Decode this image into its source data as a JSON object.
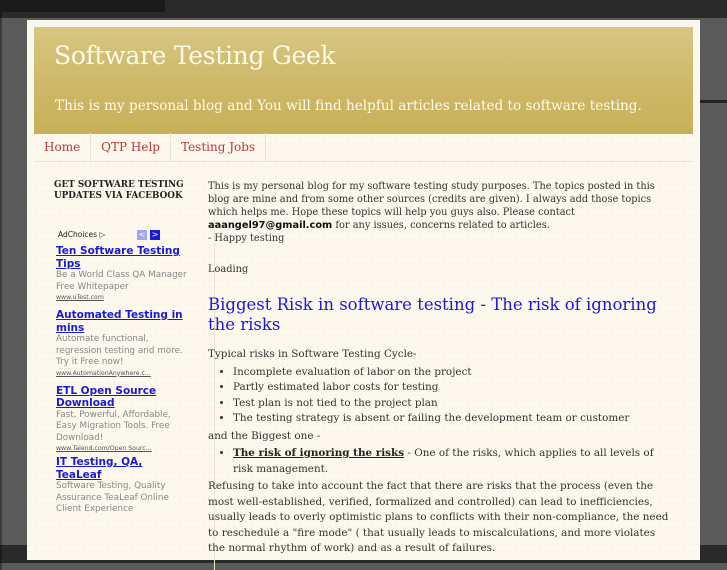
{
  "header": {
    "title": "Software Testing Geek",
    "description": "This is my personal blog and You will find helpful articles related to software testing."
  },
  "nav": {
    "items": [
      {
        "label": "Home"
      },
      {
        "label": "QTP Help"
      },
      {
        "label": "Testing Jobs"
      }
    ]
  },
  "sidebar": {
    "title": "GET SOFTWARE TESTING UPDATES VIA FACEBOOK",
    "adchoices_label": "AdChoices",
    "adchoices_icon": "adchoices-icon",
    "prev_icon": "chevron-left-icon",
    "next_icon": "chevron-right-icon",
    "prev_glyph": "<",
    "next_glyph": ">",
    "ads": [
      {
        "title": "Ten Software Testing Tips",
        "text": "Be a World Class QA Manager Free Whitepaper",
        "url": "www.uTest.com"
      },
      {
        "title": "Automated Testing in mins",
        "text": "Automate functional, regression testing and more. Try it Free now!",
        "url": "www.AutomationAnywhere.c..."
      },
      {
        "title": "ETL Open Source Download",
        "text": "Fast, Powerful, Affordable, Easy Migration Tools. Free Download!",
        "url": "www.Talend.com/Open Sourc..."
      },
      {
        "title": "IT Testing, QA, TeaLeaf",
        "text": "Software Testing, Quality Assurance TeaLeaf Online Client Experience",
        "url": ""
      }
    ]
  },
  "main": {
    "intro_before_email": "This is my personal blog for my software testing study purposes. The topics posted in this blog are mine and from some other sources (credits are given). I always add those topics which helps me. Hope these topics will help you guys also. Please contact ",
    "email": "aaangel97@gmail.com",
    "intro_after_email": " for any issues, concerns related to articles.",
    "signoff": "- Happy testing",
    "loading": "Loading",
    "post": {
      "title": "Biggest Risk in software testing - The risk of ignoring the risks",
      "lead": "Typical risks in Software Testing Cycle-",
      "risks": [
        "Incomplete evaluation of labor on the project",
        "Partly estimated labor costs for testing",
        "Test plan is not tied to the project plan",
        "The testing strategy is absent or failing the development team or customer"
      ],
      "biggest_lead": "and the Biggest one -",
      "biggest_link": "The risk of ignoring the risks",
      "biggest_text": " - One of the risks, which applies to all levels of risk management.",
      "paragraph": "Refusing to take into account the fact that there are risks that the process (even the most well-established, verified, formalized and controlled) can lead to inefficiencies, usually leads to overly optimistic plans to conflicts with their non-compliance, the need to reschedule a \"fire mode\" ( that usually leads to miscalculations, and more violates the normal rhythm of work) and as a result of failures."
    }
  }
}
